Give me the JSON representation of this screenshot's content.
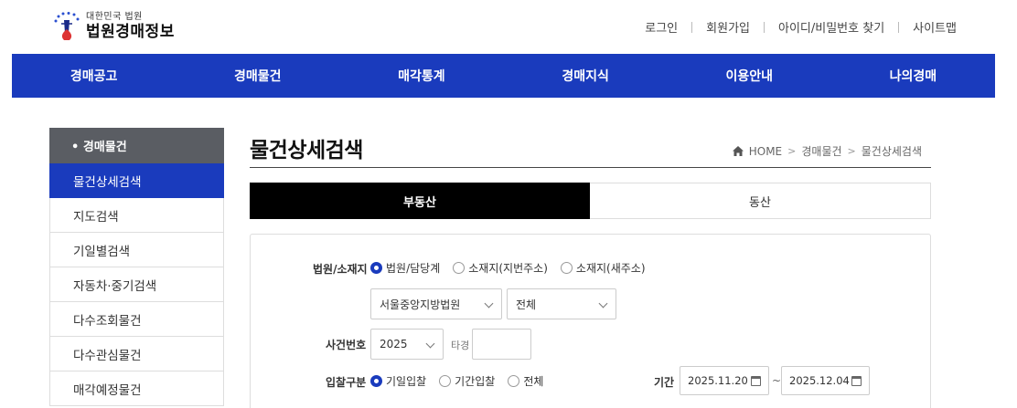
{
  "header": {
    "logo_sub": "대한민국 법원",
    "logo_main": "법원경매정보",
    "links": [
      "로그인",
      "회원가입",
      "아이디/비밀번호 찾기",
      "사이트맵"
    ]
  },
  "gnb": [
    "경매공고",
    "경매물건",
    "매각통계",
    "경매지식",
    "이용안내",
    "나의경매"
  ],
  "sidebar": {
    "head": "• 경매물건",
    "items": [
      "물건상세검색",
      "지도검색",
      "기일별검색",
      "자동차·중기검색",
      "다수조회물건",
      "다수관심물건",
      "매각예정물건"
    ]
  },
  "page": {
    "title": "물건상세검색",
    "breadcrumb": [
      "HOME",
      "경매물건",
      "물건상세검색"
    ]
  },
  "tabs": [
    "부동산",
    "동산"
  ],
  "form": {
    "court_label": "법원/소재지",
    "court_options": [
      "법원/담당계",
      "소재지(지번주소)",
      "소재지(새주소)"
    ],
    "court_select": "서울중앙지방법원",
    "dept_select": "전체",
    "case_label": "사건번호",
    "case_year": "2025",
    "case_type": "타경",
    "bid_label": "입찰구분",
    "bid_options": [
      "기일입찰",
      "기간입찰",
      "전체"
    ],
    "period_label": "기간",
    "date_from": "2025.11.20",
    "date_to": "2025.12.04",
    "tilde": "~"
  },
  "colors": {
    "primary": "#1a3bbd",
    "sidebar_head": "#5a5d63"
  }
}
